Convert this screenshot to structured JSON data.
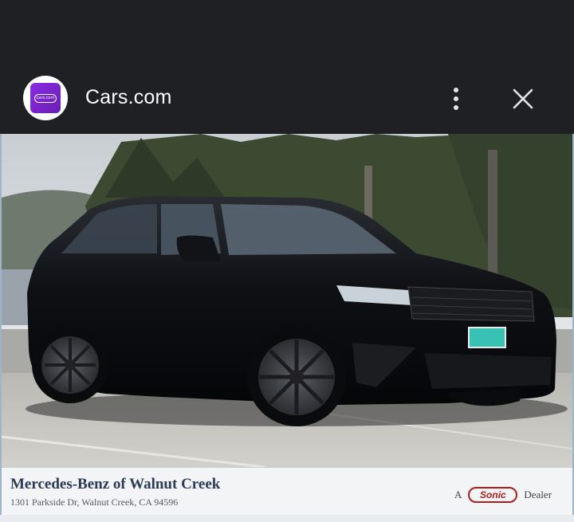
{
  "header": {
    "site_name": "Cars.com",
    "logo_text": "cars.com",
    "menu_icon": "more-vert-icon",
    "close_icon": "close-icon"
  },
  "listing_photo": {
    "alt": "Black Range Rover Velar SUV parked in lot",
    "plate_text": "",
    "dealer_name": "Mercedes-Benz of Walnut Creek",
    "dealer_address": "1301 Parkside Dr, Walnut Creek, CA 94596",
    "dealer_prefix": "A",
    "dealer_brand": "Sonic",
    "dealer_suffix": "Dealer"
  },
  "colors": {
    "background": "#1f2023",
    "logo_purple": "#7b22d3",
    "vehicle": "#0d0f12",
    "banner_text": "#2b3a55",
    "sonic_red": "#b01c1c"
  }
}
